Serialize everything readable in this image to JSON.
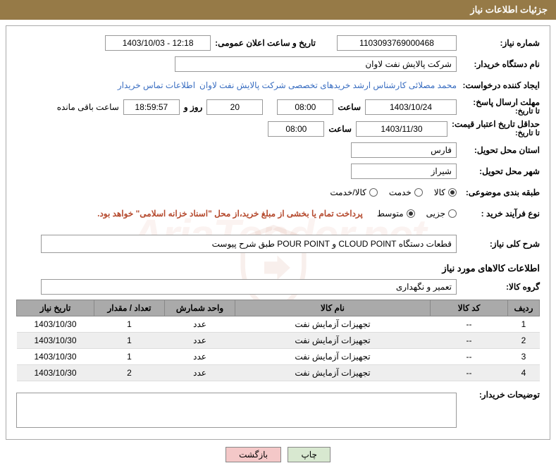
{
  "header": {
    "title": "جزئیات اطلاعات نیاز"
  },
  "fields": {
    "need_no_label": "شماره نیاز:",
    "need_no": "1103093769000468",
    "announce_label": "تاریخ و ساعت اعلان عمومی:",
    "announce_value": "1403/10/03 - 12:18",
    "buyer_org_label": "نام دستگاه خریدار:",
    "buyer_org": "شرکت پالایش نفت لاوان",
    "requester_label": "ایجاد کننده درخواست:",
    "requester": "محمد مصلائی کارشناس ارشد خریدهای تخصصی شرکت پالایش نفت لاوان",
    "contact_link": "اطلاعات تماس خریدار",
    "reply_deadline_label1": "مهلت ارسال پاسخ:",
    "reply_deadline_label2": "تا تاریخ:",
    "reply_date": "1403/10/24",
    "hour_label": "ساعت",
    "reply_hour": "08:00",
    "remain_days": "20",
    "day_and_label": "روز و",
    "remain_time": "18:59:57",
    "remain_suffix": "ساعت باقی مانده",
    "quote_valid_label1": "حداقل تاریخ اعتبار قیمت:",
    "quote_valid_label2": "تا تاریخ:",
    "quote_date": "1403/11/30",
    "quote_hour": "08:00",
    "province_label": "استان محل تحویل:",
    "province": "فارس",
    "city_label": "شهر محل تحویل:",
    "city": "شیراز",
    "category_label": "طبقه بندی موضوعی:",
    "cat_goods": "کالا",
    "cat_service": "خدمت",
    "cat_goods_service": "کالا/خدمت",
    "purchase_type_label": "نوع فرآیند خرید :",
    "pt_minor": "جزیی",
    "pt_medium": "متوسط",
    "payment_note": "پرداخت تمام یا بخشی از مبلغ خرید،از محل \"اسناد خزانه اسلامی\" خواهد بود.",
    "overall_desc_label": "شرح کلی نیاز:",
    "overall_desc": "قطعات دستگاه CLOUD POINT و POUR POINT طبق شرح پیوست",
    "items_title": "اطلاعات کالاهای مورد نیاز",
    "item_group_label": "گروه کالا:",
    "item_group": "تعمیر و نگهداری",
    "buyer_notes_label": "توضیحات خریدار:"
  },
  "table": {
    "headers": {
      "row": "ردیف",
      "code": "کد کالا",
      "name": "نام کالا",
      "unit": "واحد شمارش",
      "qty": "تعداد / مقدار",
      "date": "تاریخ نیاز"
    },
    "rows": [
      {
        "n": "1",
        "code": "--",
        "name": "تجهیزات آزمایش نفت",
        "unit": "عدد",
        "qty": "1",
        "date": "1403/10/30"
      },
      {
        "n": "2",
        "code": "--",
        "name": "تجهیزات آزمایش نفت",
        "unit": "عدد",
        "qty": "1",
        "date": "1403/10/30"
      },
      {
        "n": "3",
        "code": "--",
        "name": "تجهیزات آزمایش نفت",
        "unit": "عدد",
        "qty": "1",
        "date": "1403/10/30"
      },
      {
        "n": "4",
        "code": "--",
        "name": "تجهیزات آزمایش نفت",
        "unit": "عدد",
        "qty": "2",
        "date": "1403/10/30"
      }
    ]
  },
  "buttons": {
    "print": "چاپ",
    "back": "بازگشت"
  },
  "watermark": "AriaTender.net"
}
